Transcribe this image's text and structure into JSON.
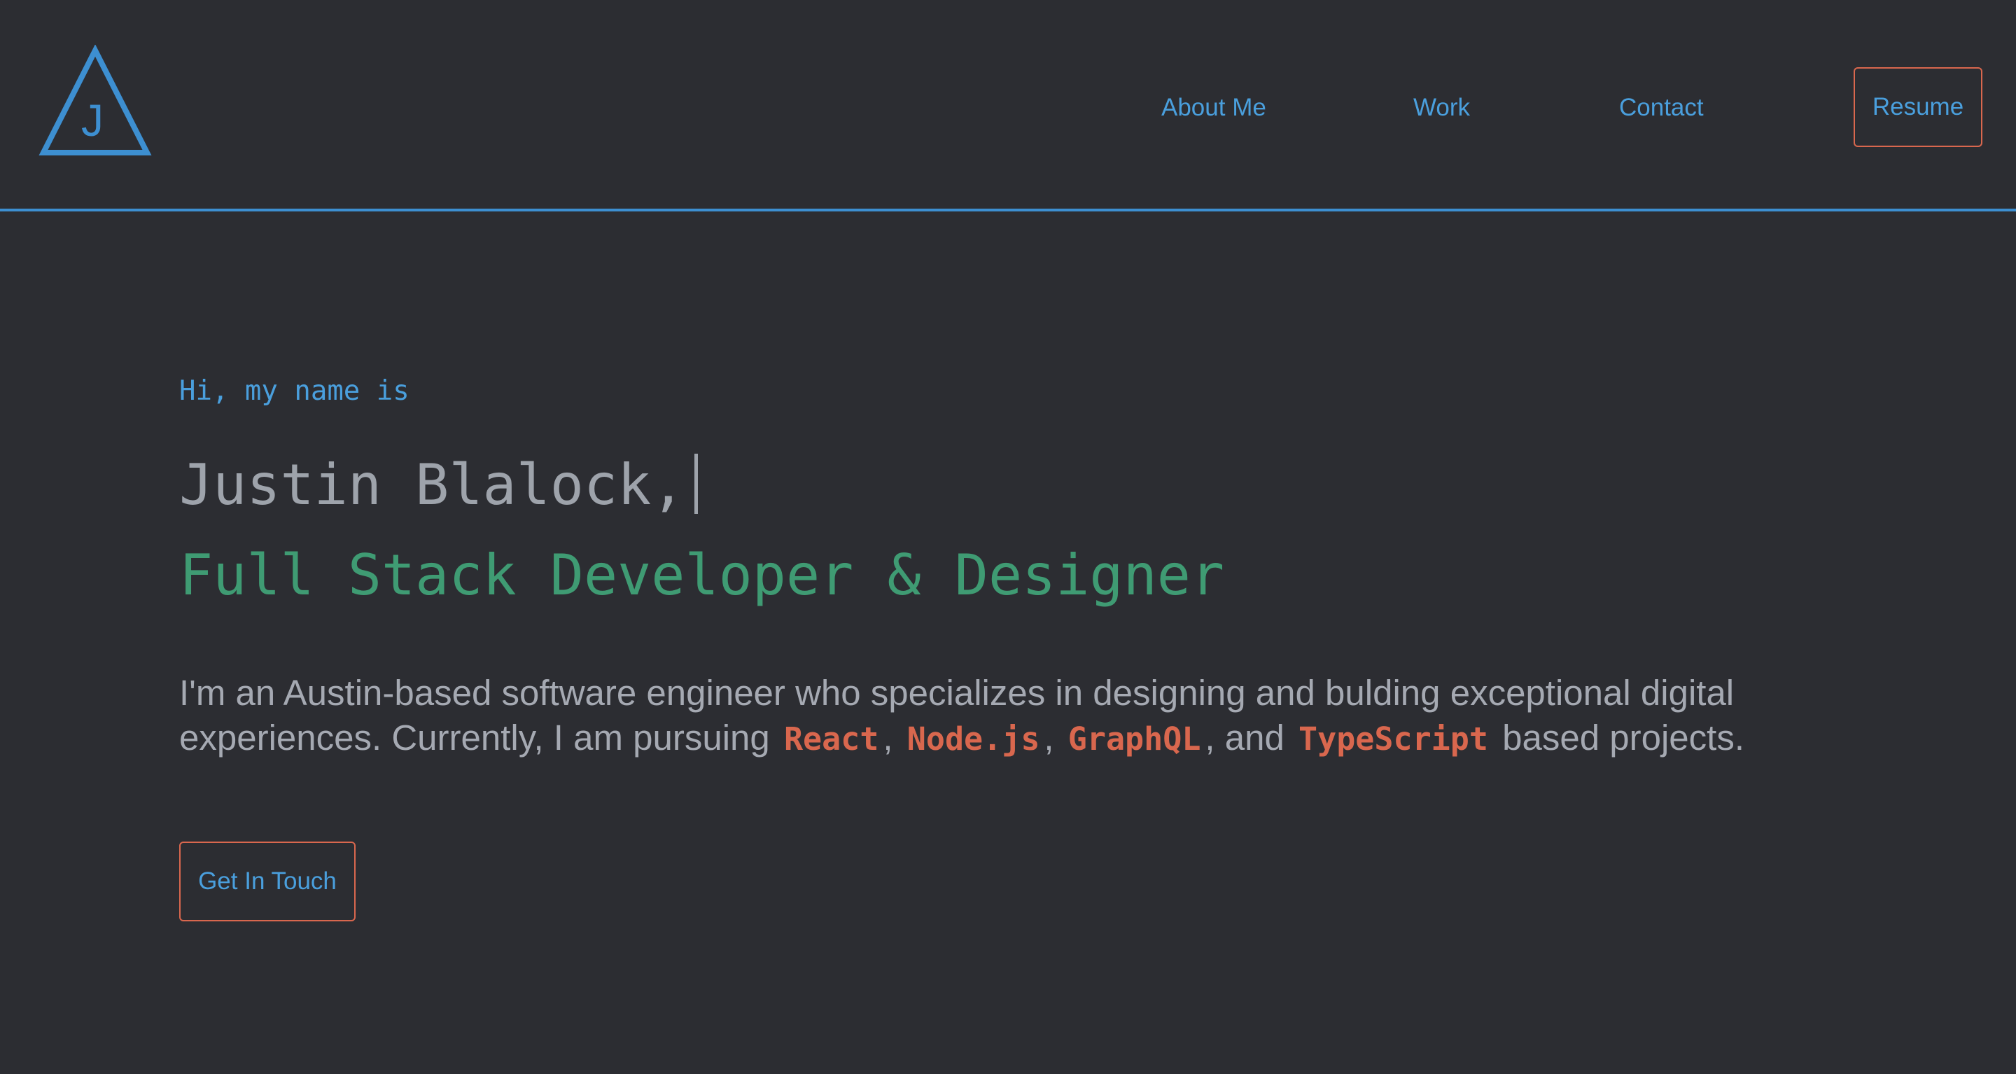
{
  "logo": {
    "letter": "J",
    "icon": "triangle-logo-icon"
  },
  "nav": {
    "items": [
      {
        "label": "About Me"
      },
      {
        "label": "Work"
      },
      {
        "label": "Contact"
      }
    ],
    "resume_label": "Resume"
  },
  "hero": {
    "greeting": "Hi, my name is",
    "name": "Justin Blalock,",
    "role": "Full Stack Developer & Designer",
    "bio": {
      "part1": "I'm an Austin-based software engineer who specializes in designing and bulding exceptional digital experiences. Currently, I am pursuing",
      "tech": [
        "React",
        "Node.js",
        "GraphQL",
        "TypeScript"
      ],
      "sep1": ",",
      "sep2": ",",
      "sep3": ", and",
      "part2": "based projects."
    },
    "cta_label": "Get In Touch"
  },
  "colors": {
    "background": "#2c2d32",
    "accent_blue": "#4a9fdd",
    "accent_orange": "#d9674e",
    "accent_green": "#3f9b73",
    "text_gray": "#a5a9b2"
  }
}
